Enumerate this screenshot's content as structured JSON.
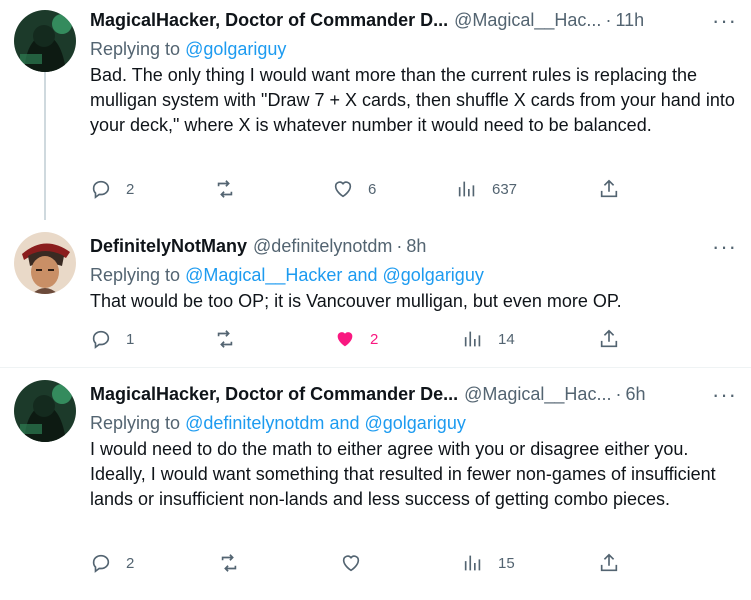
{
  "tweets": [
    {
      "name": "MagicalHacker, Doctor of Commander D...",
      "handle": "@Magical__Hac...",
      "time": "11h",
      "replying_prefix": "Replying to",
      "replying_to": [
        "@golgariguy"
      ],
      "text": "Bad. The only thing I would want more than the current rules is replacing the mulligan system with \"Draw 7 + X cards, then shuffle X cards from your hand into your deck,\" where X is whatever number it would need to be balanced.",
      "replies": "2",
      "retweets": "",
      "likes": "6",
      "views": "637",
      "liked": false
    },
    {
      "name": "DefinitelyNotMany",
      "handle": "@definitelynotdm",
      "time": "8h",
      "replying_prefix": "Replying to",
      "replying_to": [
        "@Magical__Hacker",
        "@golgariguy"
      ],
      "replying_and": "and",
      "text": "That would be too OP; it is Vancouver mulligan, but even more OP.",
      "replies": "1",
      "retweets": "",
      "likes": "2",
      "views": "14",
      "liked": true
    },
    {
      "name": "MagicalHacker, Doctor of Commander De...",
      "handle": "@Magical__Hac...",
      "time": "6h",
      "replying_prefix": "Replying to",
      "replying_to": [
        "@definitelynotdm",
        "@golgariguy"
      ],
      "replying_and": "and",
      "text": "I would need to do the math to either agree with you or disagree either you. Ideally, I would want something that resulted in fewer non-games of insufficient lands or insufficient non-lands and less success of getting combo pieces.",
      "replies": "2",
      "retweets": "",
      "likes": "",
      "views": "15",
      "liked": false
    }
  ],
  "colors": {
    "link": "#1d9bf0",
    "muted": "#536471",
    "like_active": "#f91880",
    "text": "#0f1419"
  },
  "icons": [
    "reply-icon",
    "retweet-icon",
    "like-icon",
    "views-icon",
    "share-icon",
    "more-icon"
  ]
}
